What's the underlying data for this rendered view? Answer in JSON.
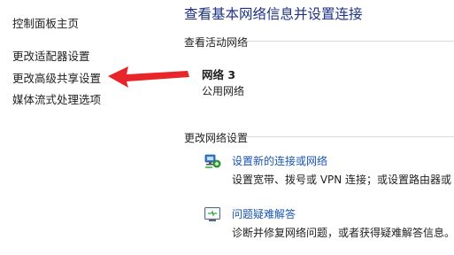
{
  "sidebar": {
    "items": [
      {
        "label": "控制面板主页"
      },
      {
        "label": "更改适配器设置"
      },
      {
        "label": "更改高级共享设置"
      },
      {
        "label": "媒体流式处理选项"
      }
    ]
  },
  "main": {
    "title": "查看基本网络信息并设置连接",
    "active_networks": {
      "heading": "查看活动网络",
      "network_name": "网络 3",
      "network_type": "公用网络"
    },
    "change_settings": {
      "heading": "更改网络设置",
      "tasks": [
        {
          "link": "设置新的连接或网络",
          "desc": "设置宽带、拨号或 VPN 连接；或设置路由器或",
          "icon": "network-setup-icon"
        },
        {
          "link": "问题疑难解答",
          "desc": "诊断并修复网络问题，或者获得疑难解答信息。",
          "icon": "troubleshoot-icon"
        }
      ]
    }
  },
  "annotation": {
    "color": "#e8262a"
  }
}
